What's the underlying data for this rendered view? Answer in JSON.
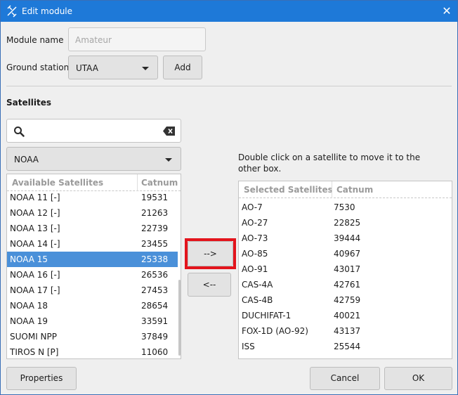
{
  "window": {
    "title": "Edit module",
    "icon": "satellite-icon",
    "close_glyph": "✕"
  },
  "form": {
    "module_name_label": "Module name",
    "module_name_placeholder": "Amateur",
    "ground_station_label": "Ground station",
    "ground_station_value": "UTAA",
    "add_label": "Add"
  },
  "satellites": {
    "heading": "Satellites",
    "filter_value": "NOAA",
    "hint": "Double click on a satellite to move it to the other box.",
    "available": {
      "header_name": "Available Satellites",
      "header_catnum": "Catnum",
      "rows": [
        {
          "name": "NOAA 11 [-]",
          "catnum": "19531"
        },
        {
          "name": "NOAA 12 [-]",
          "catnum": "21263"
        },
        {
          "name": "NOAA 13 [-]",
          "catnum": "22739"
        },
        {
          "name": "NOAA 14 [-]",
          "catnum": "23455"
        },
        {
          "name": "NOAA 15",
          "catnum": "25338"
        },
        {
          "name": "NOAA 16 [-]",
          "catnum": "26536"
        },
        {
          "name": "NOAA 17 [-]",
          "catnum": "27453"
        },
        {
          "name": "NOAA 18",
          "catnum": "28654"
        },
        {
          "name": "NOAA 19",
          "catnum": "33591"
        },
        {
          "name": "SUOMI NPP",
          "catnum": "37849"
        },
        {
          "name": "TIROS N [P]",
          "catnum": "11060"
        }
      ]
    },
    "selected": {
      "header_name": "Selected Satellites",
      "header_catnum": "Catnum",
      "rows": [
        {
          "name": "AO-7",
          "catnum": "7530"
        },
        {
          "name": "AO-27",
          "catnum": "22825"
        },
        {
          "name": "AO-73",
          "catnum": "39444"
        },
        {
          "name": "AO-85",
          "catnum": "40967"
        },
        {
          "name": "AO-91",
          "catnum": "43017"
        },
        {
          "name": "CAS-4A",
          "catnum": "42761"
        },
        {
          "name": "CAS-4B",
          "catnum": "42759"
        },
        {
          "name": "DUCHIFAT-1",
          "catnum": "40021"
        },
        {
          "name": "FOX-1D (AO-92)",
          "catnum": "43137"
        },
        {
          "name": "ISS",
          "catnum": "25544"
        }
      ]
    },
    "move_right_label": "-->",
    "move_left_label": "<--"
  },
  "footer": {
    "properties_label": "Properties",
    "cancel_label": "Cancel",
    "ok_label": "OK"
  },
  "colors": {
    "titlebar": "#1e79d8",
    "selection": "#4a90d9",
    "highlight": "#e3141c"
  }
}
